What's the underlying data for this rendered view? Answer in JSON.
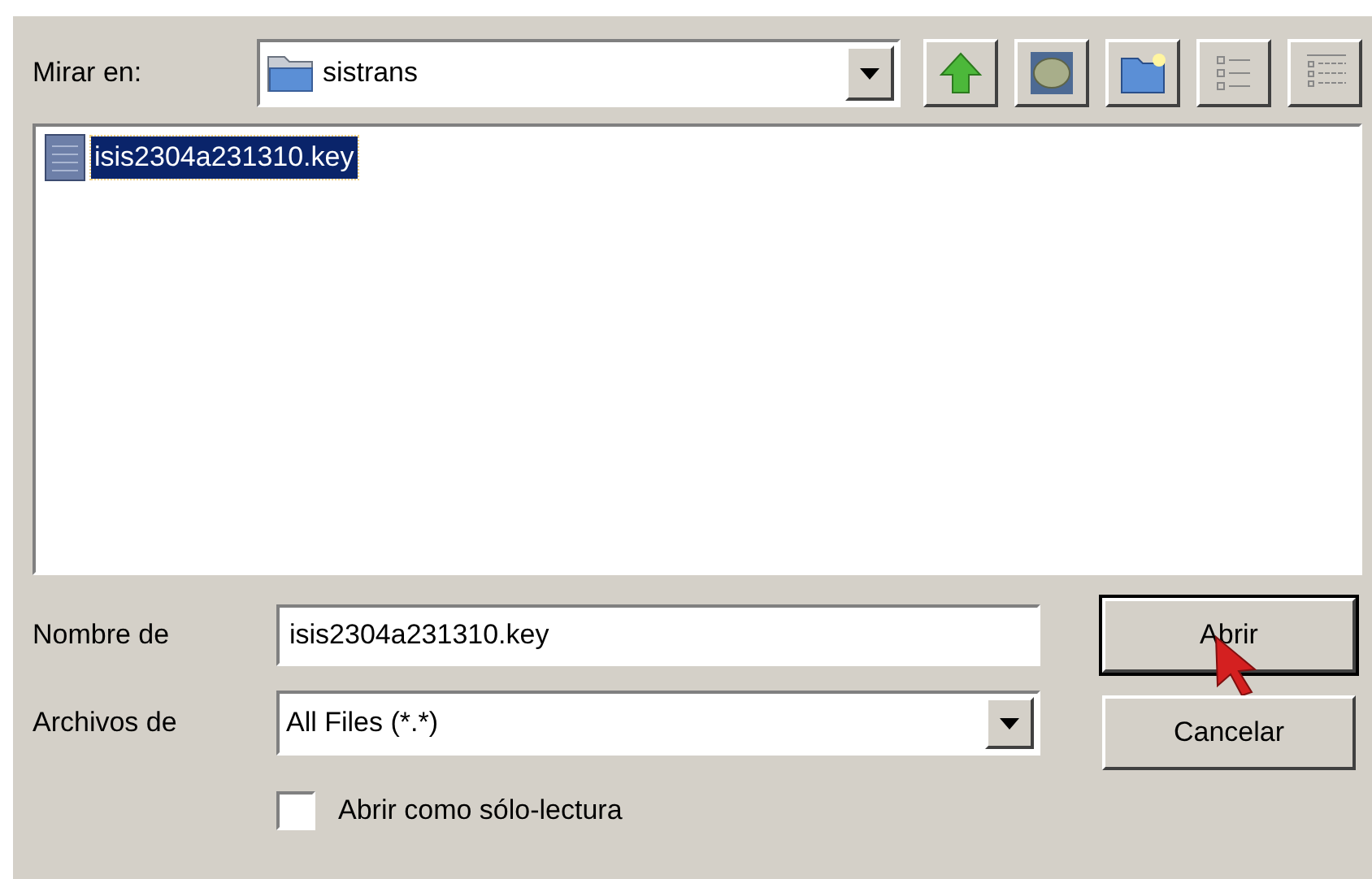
{
  "look_in": {
    "label": "Mirar en:",
    "value": "sistrans"
  },
  "toolbar": [
    {
      "kind": "up"
    },
    {
      "kind": "desktop"
    },
    {
      "kind": "new-folder"
    },
    {
      "kind": "list"
    },
    {
      "kind": "details"
    }
  ],
  "files": [
    {
      "name": "isis2304a231310.key",
      "selected": true
    }
  ],
  "file_name": {
    "label": "Nombre de",
    "value": "isis2304a231310.key"
  },
  "file_type": {
    "label": "Archivos de",
    "value": "All Files (*.*)"
  },
  "read_only": {
    "label": "Abrir como sólo-lectura",
    "checked": false
  },
  "buttons": [
    {
      "label": "Abrir",
      "default": true,
      "cursor": true
    },
    {
      "label": "Cancelar",
      "default": false,
      "cursor": false
    }
  ]
}
